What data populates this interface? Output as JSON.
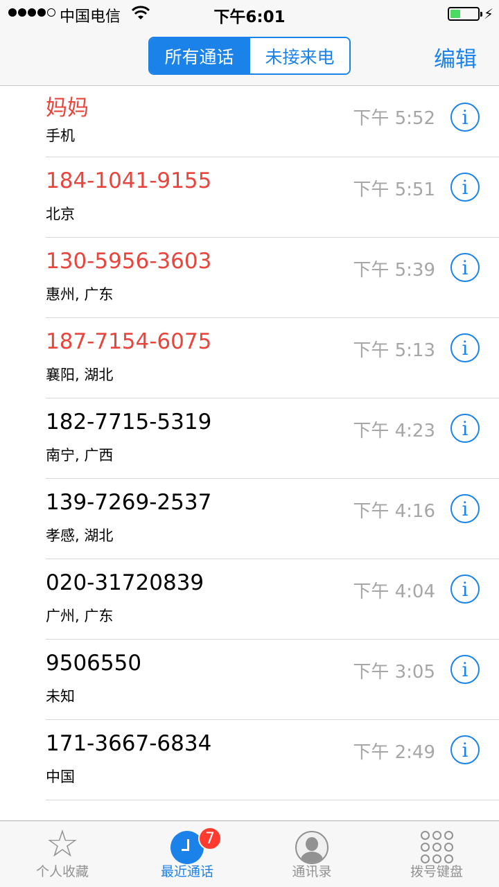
{
  "status_bar": {
    "carrier": "中国电信",
    "time": "下午6:01",
    "battery_level": 0.35,
    "battery_color": "#4cd964",
    "signal_bars": 4,
    "icons": [
      "wifi-icon",
      "battery-icon",
      "bolt-icon"
    ]
  },
  "nav": {
    "segments": [
      "所有通话",
      "未接来电"
    ],
    "active_segment": 0,
    "edit_label": "编辑"
  },
  "calls": [
    {
      "caller": "妈妈",
      "location": "手机",
      "time": "下午 5:52",
      "missed": true
    },
    {
      "caller": "184-1041-9155",
      "location": "北京",
      "time": "下午 5:51",
      "missed": true
    },
    {
      "caller": "130-5956-3603",
      "location": "惠州, 广东",
      "time": "下午 5:39",
      "missed": true
    },
    {
      "caller": "187-7154-6075",
      "location": "襄阳, 湖北",
      "time": "下午 5:13",
      "missed": true
    },
    {
      "caller": "182-7715-5319",
      "location": "南宁, 广西",
      "time": "下午 4:23",
      "missed": false
    },
    {
      "caller": "139-7269-2537",
      "location": "孝感, 湖北",
      "time": "下午 4:16",
      "missed": false
    },
    {
      "caller": "020-31720839",
      "location": "广州, 广东",
      "time": "下午 4:04",
      "missed": false
    },
    {
      "caller": "9506550",
      "location": "未知",
      "time": "下午 3:05",
      "missed": false
    },
    {
      "caller": "171-3667-6834",
      "location": "中国",
      "time": "下午 2:49",
      "missed": false
    }
  ],
  "info_glyph": "i",
  "tabs": [
    {
      "label": "个人收藏",
      "icon": "star-icon"
    },
    {
      "label": "最近通话",
      "icon": "recents-icon",
      "badge": "7"
    },
    {
      "label": "通讯录",
      "icon": "contact-icon"
    },
    {
      "label": "拨号键盘",
      "icon": "keypad-icon"
    }
  ],
  "colors": {
    "accent": "#1a82e8",
    "missed": "#e8453c",
    "badge": "#ff3b30"
  }
}
